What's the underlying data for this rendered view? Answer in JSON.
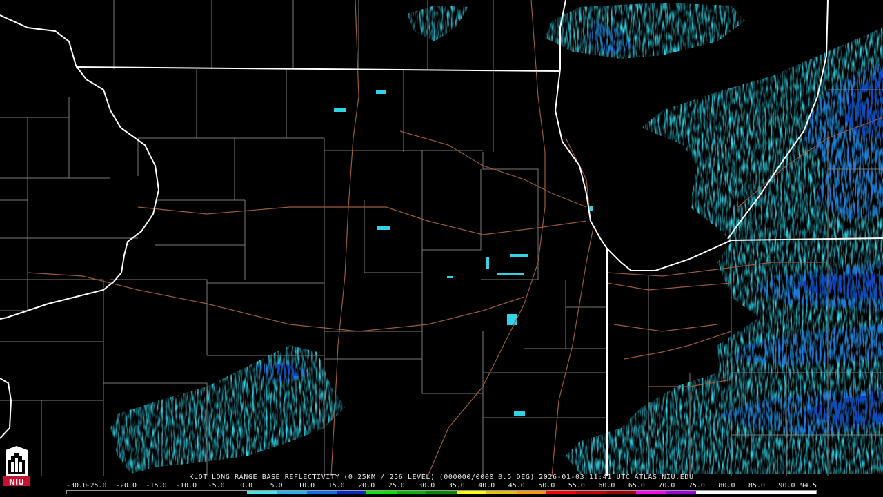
{
  "product": {
    "station": "KLOT",
    "name": "LONG RANGE BASE REFLECTIVITY",
    "resolution": "(0.25KM / 256 LEVEL)",
    "volume": "(000000/0000",
    "tilt": "0.5 DEG)",
    "datetime": "2026-01-03 11:41 UTC",
    "source": "ATLAS.NIU.EDU"
  },
  "scale": {
    "labels": [
      "-30.0",
      "-25.0",
      "-20.0",
      "-15.0",
      "-10.0",
      "-5.0",
      "0.0",
      "5.0",
      "10.0",
      "15.0",
      "20.0",
      "25.0",
      "30.0",
      "35.0",
      "40.0",
      "45.0",
      "50.0",
      "55.0",
      "60.0",
      "65.0",
      "70.0",
      "75.0",
      "80.0",
      "85.0",
      "90.0",
      "94.5"
    ],
    "colors": [
      "#000000",
      "#000000",
      "#000000",
      "#000000",
      "#000000",
      "#000000",
      "#3ce8e8",
      "#1eb4f0",
      "#0a6ef0",
      "#0028c8",
      "#00e600",
      "#00b400",
      "#008c00",
      "#ffff00",
      "#e6be00",
      "#ff9600",
      "#ff0000",
      "#c80000",
      "#a00000",
      "#ff00ff",
      "#a000e6",
      "#ffffff",
      "#ffffff",
      "#ffffff",
      "#ffffff"
    ]
  },
  "logo": {
    "text": "NIU",
    "color": "#c8102e"
  },
  "map": {
    "background": "#000000",
    "state_line_color": "#ffffff",
    "county_line_color": "#7a7a7a",
    "road_color": "#9c5a3c"
  }
}
